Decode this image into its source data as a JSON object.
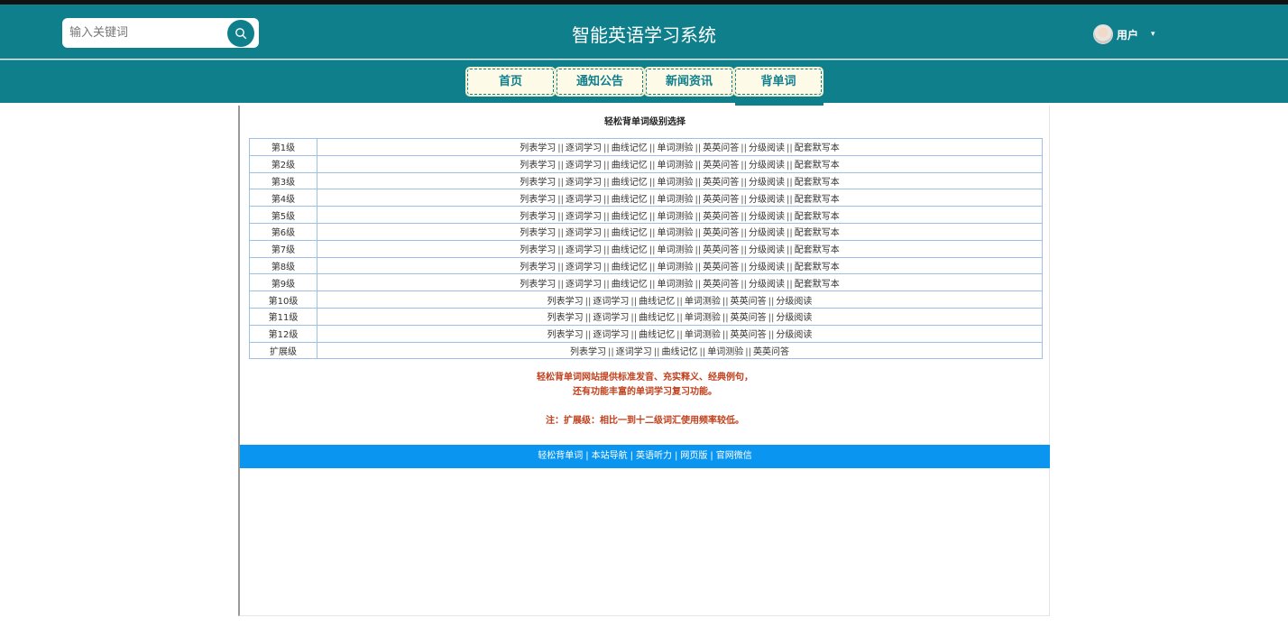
{
  "header": {
    "search_placeholder": "输入关键词",
    "title": "智能英语学习系统",
    "user_label": "用户",
    "caret": "▾"
  },
  "nav": {
    "items": [
      {
        "label": "首页"
      },
      {
        "label": "通知公告"
      },
      {
        "label": "新闻资讯"
      },
      {
        "label": "背单词"
      }
    ],
    "active": "背单词"
  },
  "content": {
    "title": "轻松背单词级别选择",
    "rows": [
      {
        "level": "第1级",
        "links": [
          "列表学习",
          "逐词学习",
          "曲线记忆",
          "单词测验",
          "英英问答",
          "分级阅读",
          "配套默写本"
        ]
      },
      {
        "level": "第2级",
        "links": [
          "列表学习",
          "逐词学习",
          "曲线记忆",
          "单词测验",
          "英英问答",
          "分级阅读",
          "配套默写本"
        ]
      },
      {
        "level": "第3级",
        "links": [
          "列表学习",
          "逐词学习",
          "曲线记忆",
          "单词测验",
          "英英问答",
          "分级阅读",
          "配套默写本"
        ]
      },
      {
        "level": "第4级",
        "links": [
          "列表学习",
          "逐词学习",
          "曲线记忆",
          "单词测验",
          "英英问答",
          "分级阅读",
          "配套默写本"
        ]
      },
      {
        "level": "第5级",
        "links": [
          "列表学习",
          "逐词学习",
          "曲线记忆",
          "单词测验",
          "英英问答",
          "分级阅读",
          "配套默写本"
        ]
      },
      {
        "level": "第6级",
        "links": [
          "列表学习",
          "逐词学习",
          "曲线记忆",
          "单词测验",
          "英英问答",
          "分级阅读",
          "配套默写本"
        ]
      },
      {
        "level": "第7级",
        "links": [
          "列表学习",
          "逐词学习",
          "曲线记忆",
          "单词测验",
          "英英问答",
          "分级阅读",
          "配套默写本"
        ]
      },
      {
        "level": "第8级",
        "links": [
          "列表学习",
          "逐词学习",
          "曲线记忆",
          "单词测验",
          "英英问答",
          "分级阅读",
          "配套默写本"
        ]
      },
      {
        "level": "第9级",
        "links": [
          "列表学习",
          "逐词学习",
          "曲线记忆",
          "单词测验",
          "英英问答",
          "分级阅读",
          "配套默写本"
        ]
      },
      {
        "level": "第10级",
        "links": [
          "列表学习",
          "逐词学习",
          "曲线记忆",
          "单词测验",
          "英英问答",
          "分级阅读"
        ]
      },
      {
        "level": "第11级",
        "links": [
          "列表学习",
          "逐词学习",
          "曲线记忆",
          "单词测验",
          "英英问答",
          "分级阅读"
        ]
      },
      {
        "level": "第12级",
        "links": [
          "列表学习",
          "逐词学习",
          "曲线记忆",
          "单词测验",
          "英英问答",
          "分级阅读"
        ]
      },
      {
        "level": "扩展级",
        "links": [
          "列表学习",
          "逐词学习",
          "曲线记忆",
          "单词测验",
          "英英问答"
        ]
      }
    ],
    "link_separator": "||",
    "note_line1": "轻松背单词网站提供标准发音、充实释义、经典例句，",
    "note_line2": "还有功能丰富的单词学习复习功能。",
    "note_line3": "注：扩展级：相比一到十二级词汇使用频率较低。"
  },
  "footer": {
    "links": [
      "轻松背单词",
      "本站导航",
      "英语听力",
      "网页版",
      "官网微信"
    ],
    "separator": "|"
  },
  "colors": {
    "header_bg": "#0f7f8c",
    "footer_bg": "#0a96f0",
    "note_text": "#c0401c"
  }
}
